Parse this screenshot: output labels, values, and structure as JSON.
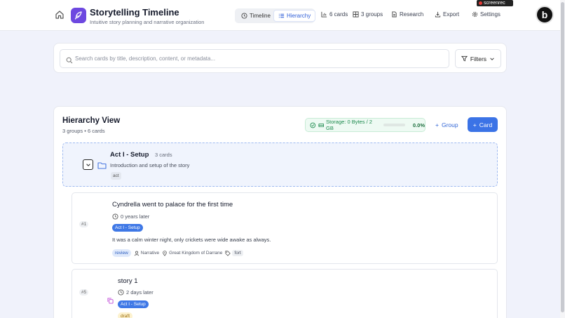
{
  "header": {
    "app_title": "Storytelling Timeline",
    "app_subtitle": "Intuitive story planning and narrative organization",
    "views": [
      {
        "label": "Timeline",
        "icon": "clock-icon",
        "active": false
      },
      {
        "label": "Hierarchy",
        "icon": "list-icon",
        "active": true
      }
    ],
    "cards_count": "6 cards",
    "groups_count": "3 groups",
    "research_label": "Research",
    "export_label": "Export",
    "settings_label": "Settings",
    "recorder_label": "screenrec",
    "avatar_letter": "b"
  },
  "search": {
    "placeholder": "Search cards by title, description, content, or metadata...",
    "value": "",
    "filters_label": "Filters"
  },
  "hierarchy": {
    "title": "Hierarchy View",
    "subtitle": "3 groups • 6 cards",
    "storage_label": "Storage: 0 Bytes / 2 GB",
    "storage_percent": "0.0%",
    "storage_fraction": 0.0,
    "add_group_label": "Group",
    "add_card_label": "Card",
    "group": {
      "name": "Act I - Setup",
      "count": "3 cards",
      "description": "Introduction and setup of the story",
      "tag": "act"
    },
    "cards": [
      {
        "number": "#1",
        "title": "Cyndrella went to palace for the first time",
        "time": "0 years later",
        "group_pill": "Act I - Setup",
        "body": "It was a calm winter night, only crickets were wide awake as always.",
        "status": "review",
        "type": "Narrative",
        "location": "Great Kingdom of Darrane",
        "tag": "fort"
      },
      {
        "number": "#5",
        "title": "story 1",
        "time": "2 days later",
        "group_pill": "Act I - Setup",
        "status": "draft"
      }
    ]
  },
  "colors": {
    "accent": "#3b73e6",
    "brand": "#6d48e0",
    "storage_green": "#1d8a4e",
    "draft_bg": "#fdf2cf"
  }
}
